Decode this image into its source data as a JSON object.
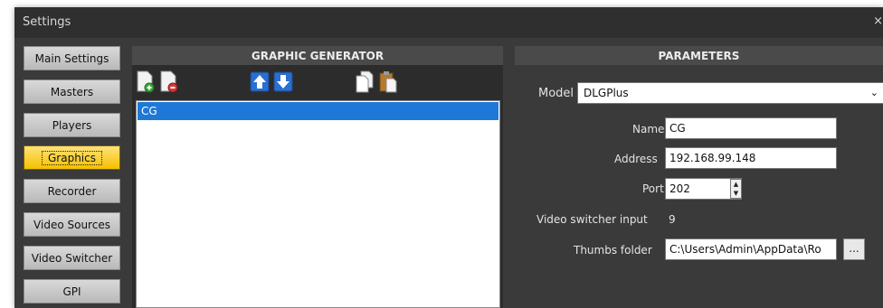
{
  "window": {
    "title": "Settings",
    "close_glyph": "×"
  },
  "nav": {
    "items": [
      {
        "label": "Main Settings"
      },
      {
        "label": "Masters"
      },
      {
        "label": "Players"
      },
      {
        "label": "Graphics",
        "active": true
      },
      {
        "label": "Recorder"
      },
      {
        "label": "Video Sources"
      },
      {
        "label": "Video Switcher"
      },
      {
        "label": "GPI"
      }
    ]
  },
  "graphic_generator": {
    "header": "GRAPHIC GENERATOR",
    "toolbar": [
      "add-icon",
      "remove-icon",
      "move-up-icon",
      "move-down-icon",
      "copy-icon",
      "paste-icon"
    ],
    "items": [
      "CG"
    ],
    "selected": "CG"
  },
  "parameters": {
    "header": "PARAMETERS",
    "model_label": "Model",
    "model_value": "DLGPlus",
    "name_label": "Name",
    "name_value": "CG",
    "address_label": "Address",
    "address_value": "192.168.99.148",
    "port_label": "Port",
    "port_value": "202",
    "video_switcher_label": "Video switcher input",
    "video_switcher_value": "9",
    "thumbs_label": "Thumbs folder",
    "thumbs_value": "C:\\Users\\Admin\\AppData\\Ro",
    "browse_label": "..."
  },
  "colors": {
    "accent_selected": "#1e78d8",
    "active_nav": "#f5c000",
    "background": "#3a3a3a"
  }
}
